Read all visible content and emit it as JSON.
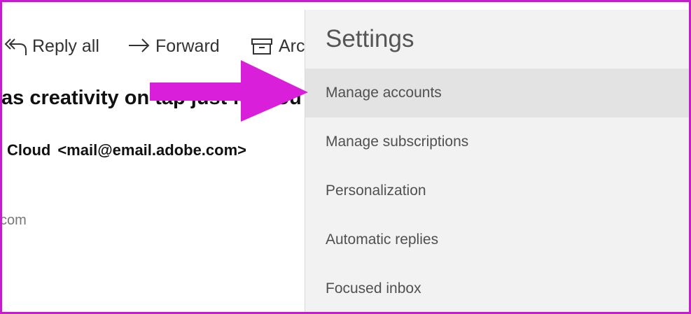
{
  "toolbar": {
    "reply_all_label": "Reply all",
    "forward_label": "Forward",
    "archive_label": "Arc"
  },
  "message": {
    "subject": "as creativity on tap just for you",
    "sender_name": "Cloud",
    "sender_email": "<mail@email.adobe.com>",
    "snippet": "com"
  },
  "settings": {
    "title": "Settings",
    "items": [
      {
        "label": "Manage accounts"
      },
      {
        "label": "Manage subscriptions"
      },
      {
        "label": "Personalization"
      },
      {
        "label": "Automatic replies"
      },
      {
        "label": "Focused inbox"
      }
    ]
  },
  "colors": {
    "annotation_arrow": "#d91fd9",
    "frame_border": "#c81bd0",
    "selected_item_bg": "#e3e3e3",
    "settings_bg": "#f2f2f2"
  }
}
